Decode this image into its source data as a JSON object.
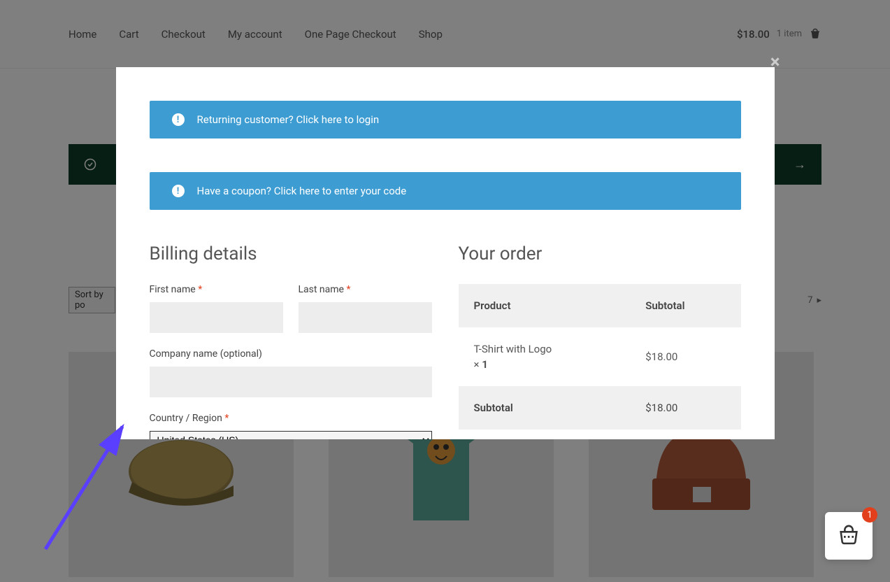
{
  "nav": {
    "items": [
      "Home",
      "Cart",
      "Checkout",
      "My account",
      "One Page Checkout",
      "Shop"
    ]
  },
  "header_cart": {
    "price": "$18.00",
    "count_label": "1 item"
  },
  "shop": {
    "sort_visible": "Sort by po",
    "pager": {
      "num": "7"
    }
  },
  "modal": {
    "close": "×",
    "login_notice": "Returning customer? Click here to login",
    "coupon_notice": "Have a coupon? Click here to enter your code",
    "billing": {
      "title": "Billing details",
      "first_name": "First name",
      "last_name": "Last name",
      "company": "Company name (optional)",
      "country": "Country / Region",
      "country_selected": "United States (US)",
      "req": "*"
    },
    "order": {
      "title": "Your order",
      "col_product": "Product",
      "col_subtotal": "Subtotal",
      "line": {
        "name": "T-Shirt with Logo",
        "qty_prefix": "× ",
        "qty": "1",
        "price": "$18.00"
      },
      "subtotal_label": "Subtotal",
      "subtotal_value": "$18.00"
    }
  },
  "float_cart": {
    "badge": "1"
  }
}
